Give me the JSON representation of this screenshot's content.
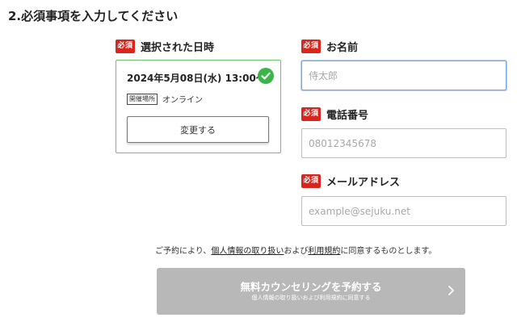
{
  "section": {
    "title": "2.必須事項を入力してください"
  },
  "required_badge": "必須",
  "selected": {
    "label": "選択された日時",
    "datetime": "2024年5月08日(水) 13:00〜",
    "venue_tag": "開催場所",
    "venue_value": "オンライン",
    "change_button": "変更する",
    "status_icon": "check-circle-icon",
    "accent_color": "#3bb54a"
  },
  "name": {
    "label": "お名前",
    "placeholder": "侍太郎",
    "value": ""
  },
  "phone": {
    "label": "電話番号",
    "placeholder": "08012345678",
    "value": ""
  },
  "email": {
    "label": "メールアドレス",
    "placeholder": "example@sejuku.net",
    "value": ""
  },
  "agreement": {
    "prefix": "ご予約により、",
    "privacy_link": "個人情報の取り扱い",
    "middle": "および",
    "terms_link": "利用規約",
    "suffix": "に同意するものとします。"
  },
  "submit": {
    "main": "無料カウンセリングを予約する",
    "sub": "個人情報の取り扱いおよび利用規約に同意する",
    "icon": "chevron-right-icon"
  },
  "colors": {
    "badge": "#d9251c",
    "button_disabled": "#b8b8b8",
    "focus": "#7aa3e6"
  }
}
